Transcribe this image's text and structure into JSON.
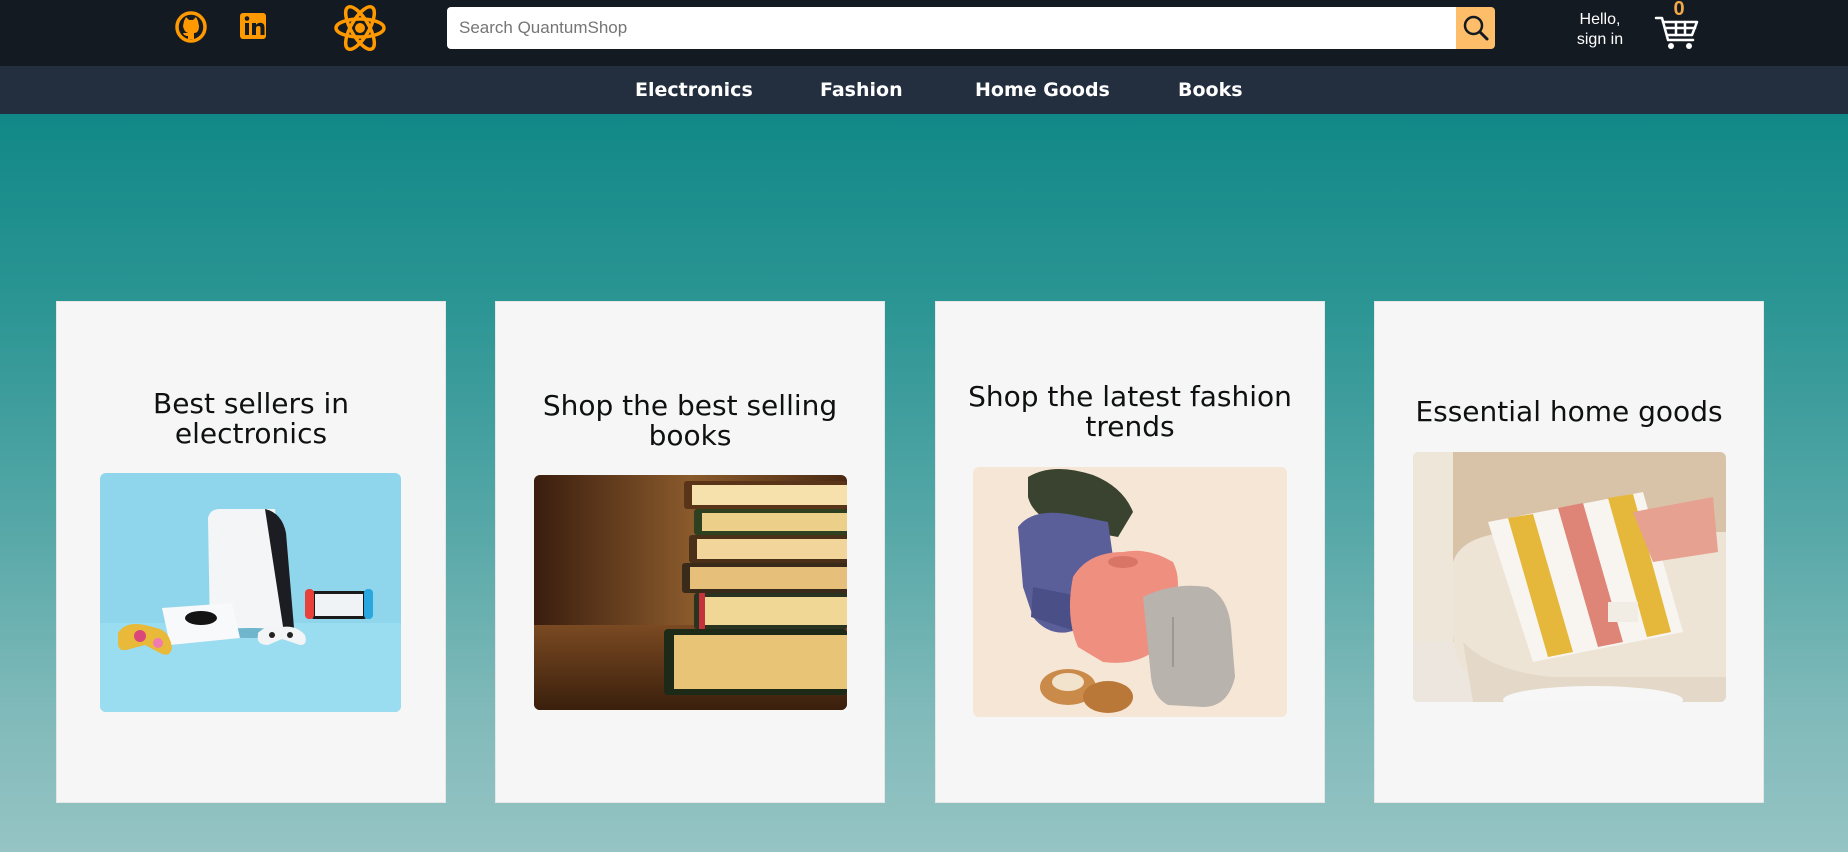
{
  "header": {
    "search": {
      "placeholder": "Search QuantumShop",
      "value": ""
    },
    "signin_line1": "Hello,",
    "signin_line2": "sign in",
    "cart_count": "0",
    "icons": [
      "github-icon",
      "linkedin-icon",
      "react-logo-icon",
      "search-icon",
      "cart-icon"
    ]
  },
  "nav": {
    "items": [
      {
        "label": "Electronics"
      },
      {
        "label": "Fashion"
      },
      {
        "label": "Home Goods"
      },
      {
        "label": "Books"
      }
    ]
  },
  "cards": [
    {
      "title_line1": "Best sellers in",
      "title_line2": "electronics",
      "image": "gaming-consoles"
    },
    {
      "title_line1": "Shop the best selling",
      "title_line2": "books",
      "image": "book-stack"
    },
    {
      "title_line1": "Shop the latest fashion",
      "title_line2": "trends",
      "image": "folded-clothes"
    },
    {
      "title_line1": "Essential home goods",
      "title_line2": "",
      "image": "blanket-on-sofa"
    }
  ],
  "colors": {
    "topbar": "#131a22",
    "navbar": "#232f3e",
    "accent": "#febd69",
    "brand_orange": "#ff9900",
    "hero_top": "#118887",
    "hero_bottom": "#96c4c4"
  }
}
